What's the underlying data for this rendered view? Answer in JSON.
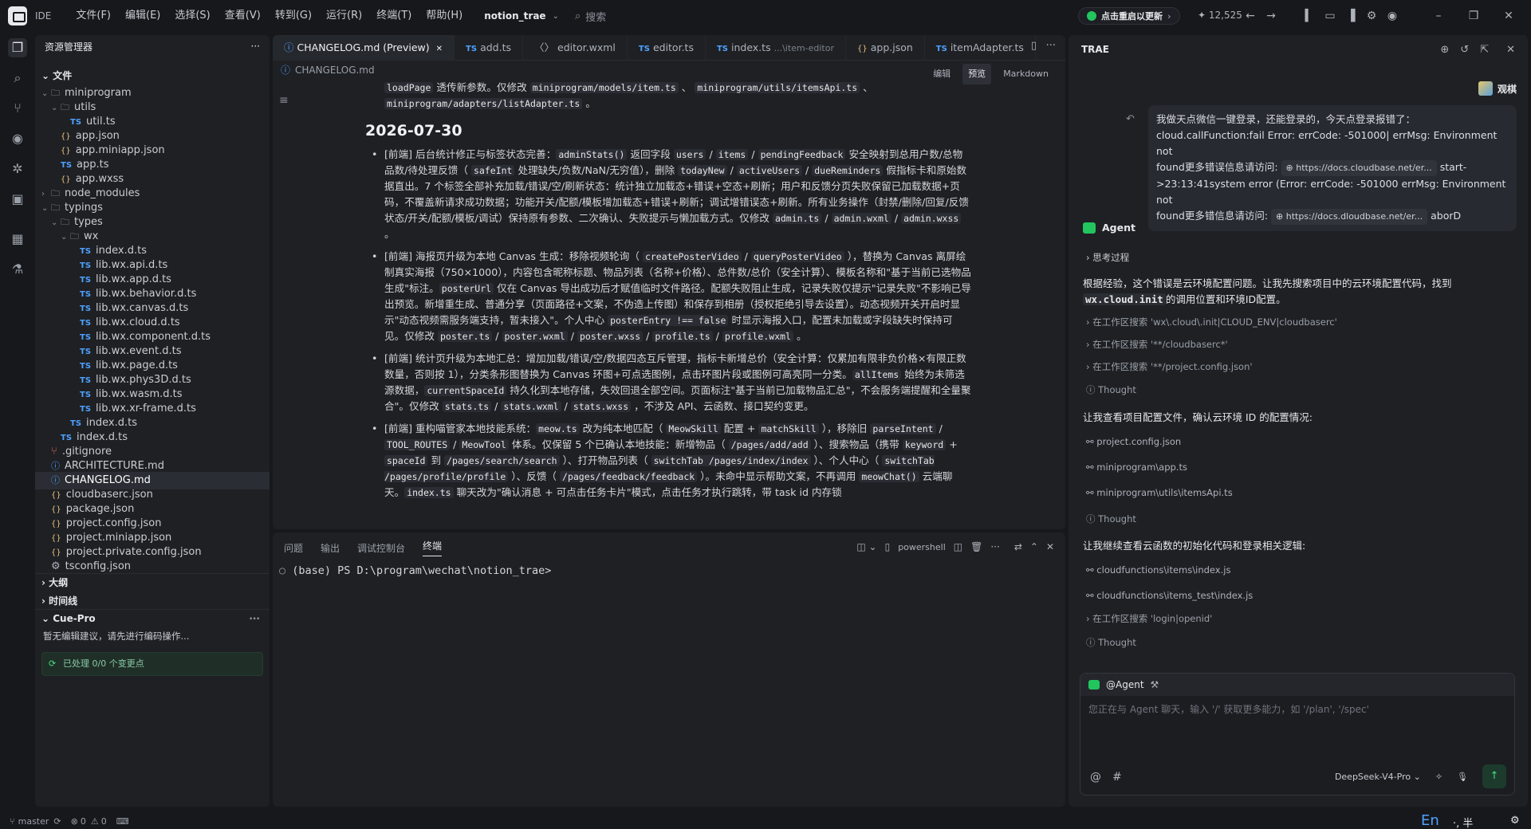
{
  "app": {
    "ide_label": "IDE",
    "project": "notion_trae",
    "search_placeholder": "搜索",
    "update_label": "点击重启以更新",
    "stars": "12,525"
  },
  "menu": [
    "文件(F)",
    "编辑(E)",
    "选择(S)",
    "查看(V)",
    "转到(G)",
    "运行(R)",
    "终端(T)",
    "帮助(H)"
  ],
  "explorer": {
    "title": "资源管理器",
    "root": "文件",
    "rows": [
      {
        "label": "miniprogram",
        "kind": "folder",
        "depth": 0,
        "chev": "v"
      },
      {
        "label": "utils",
        "kind": "folder",
        "depth": 1,
        "chev": "v"
      },
      {
        "label": "util.ts",
        "kind": "ts",
        "depth": 2
      },
      {
        "label": "app.json",
        "kind": "json",
        "depth": 1
      },
      {
        "label": "app.miniapp.json",
        "kind": "json",
        "depth": 1
      },
      {
        "label": "app.ts",
        "kind": "ts",
        "depth": 1
      },
      {
        "label": "app.wxss",
        "kind": "json",
        "depth": 1
      },
      {
        "label": "node_modules",
        "kind": "folder",
        "depth": 0,
        "chev": ">"
      },
      {
        "label": "typings",
        "kind": "folder",
        "depth": 0,
        "chev": "v"
      },
      {
        "label": "types",
        "kind": "folder",
        "depth": 1,
        "chev": "v"
      },
      {
        "label": "wx",
        "kind": "folder",
        "depth": 2,
        "chev": "v"
      },
      {
        "label": "index.d.ts",
        "kind": "ts",
        "depth": 3
      },
      {
        "label": "lib.wx.api.d.ts",
        "kind": "ts",
        "depth": 3
      },
      {
        "label": "lib.wx.app.d.ts",
        "kind": "ts",
        "depth": 3
      },
      {
        "label": "lib.wx.behavior.d.ts",
        "kind": "ts",
        "depth": 3
      },
      {
        "label": "lib.wx.canvas.d.ts",
        "kind": "ts",
        "depth": 3
      },
      {
        "label": "lib.wx.cloud.d.ts",
        "kind": "ts",
        "depth": 3
      },
      {
        "label": "lib.wx.component.d.ts",
        "kind": "ts",
        "depth": 3
      },
      {
        "label": "lib.wx.event.d.ts",
        "kind": "ts",
        "depth": 3
      },
      {
        "label": "lib.wx.page.d.ts",
        "kind": "ts",
        "depth": 3
      },
      {
        "label": "lib.wx.phys3D.d.ts",
        "kind": "ts",
        "depth": 3
      },
      {
        "label": "lib.wx.wasm.d.ts",
        "kind": "ts",
        "depth": 3
      },
      {
        "label": "lib.wx.xr-frame.d.ts",
        "kind": "ts",
        "depth": 3
      },
      {
        "label": "index.d.ts",
        "kind": "ts",
        "depth": 2
      },
      {
        "label": "index.d.ts",
        "kind": "ts",
        "depth": 1
      },
      {
        "label": ".gitignore",
        "kind": "git",
        "depth": 0
      },
      {
        "label": "ARCHITECTURE.md",
        "kind": "md",
        "depth": 0
      },
      {
        "label": "CHANGELOG.md",
        "kind": "md",
        "depth": 0,
        "selected": true
      },
      {
        "label": "cloudbaserc.json",
        "kind": "json",
        "depth": 0
      },
      {
        "label": "package.json",
        "kind": "json",
        "depth": 0
      },
      {
        "label": "project.config.json",
        "kind": "json",
        "depth": 0
      },
      {
        "label": "project.miniapp.json",
        "kind": "json",
        "depth": 0
      },
      {
        "label": "project.private.config.json",
        "kind": "json",
        "depth": 0
      },
      {
        "label": "tsconfig.json",
        "kind": "gear",
        "depth": 0
      }
    ],
    "outline": "大纲",
    "timeline": "时间线",
    "cue_title": "Cue-Pro",
    "cue_hint": "暂无编辑建议，请先进行编码操作...",
    "cue_status": "已处理 0/0 个变更点"
  },
  "editor": {
    "tabs": [
      {
        "label": "CHANGELOG.md (Preview)",
        "kind": "md",
        "active": true
      },
      {
        "label": "add.ts",
        "kind": "ts"
      },
      {
        "label": "editor.wxml",
        "kind": "xml"
      },
      {
        "label": "editor.ts",
        "kind": "ts"
      },
      {
        "label": "index.ts",
        "kind": "ts",
        "suffix": "...\\item-editor"
      },
      {
        "label": "app.json",
        "kind": "json"
      },
      {
        "label": "itemAdapter.ts",
        "kind": "ts"
      }
    ],
    "breadcrumb": "CHANGELOG.md",
    "modes": [
      "编辑",
      "预览",
      "Markdown"
    ],
    "top_line_html": "<code>loadPage</code> 透传新参数。仅修改 <code>miniprogram/models/item.ts</code> 、 <code>miniprogram/utils/itemsApi.ts</code> 、 <code>miniprogram/adapters/listAdapter.ts</code> 。",
    "heading": "2026-07-30",
    "items_html": [
      "[前端] 后台统计修正与标签状态完善：<code>adminStats()</code> 返回字段 <code>users</code> / <code>items</code> / <code>pendingFeedback</code> 安全映射到总用户数/总物品数/待处理反馈（ <code>safeInt</code> 处理缺失/负数/NaN/无穷值），删除 <code>todayNew</code> / <code>activeUsers</code> / <code>dueReminders</code> 假指标卡和原始数据直出。7 个标签全部补充加载/错误/空/刷新状态：统计独立加载态+错误+空态+刷新；用户和反馈分页失败保留已加载数据+页码，不覆盖新请求成功数据；功能开关/配额/模板增加载态+错误+刷新；调试增错误态+刷新。所有业务操作（封禁/删除/回复/反馈状态/开关/配额/模板/调试）保持原有参数、二次确认、失败提示与懒加载方式。仅修改 <code>admin.ts</code> / <code>admin.wxml</code> / <code>admin.wxss</code> 。",
      "[前端] 海报页升级为本地 Canvas 生成：移除视频轮询（ <code>createPosterVideo</code> / <code>queryPosterVideo</code> ），替换为 Canvas 离屏绘制真实海报（750×1000），内容包含昵称标题、物品列表（名称+价格）、总件数/总价（安全计算）、模板名称和\"基于当前已选物品生成\"标注。<code>posterUrl</code> 仅在 Canvas 导出成功后才赋值临时文件路径。配额失败阻止生成，记录失败仅提示\"记录失败\"不影响已导出预览。新增重生成、普通分享（页面路径+文案，不伪造上传图）和保存到相册（授权拒绝引导去设置）。动态视频开关开启时显示\"动态视频需服务端支持，暂未接入\"。个人中心 <code>posterEntry !== false</code> 时显示海报入口，配置未加载或字段缺失时保持可见。仅修改 <code>poster.ts</code> / <code>poster.wxml</code> / <code>poster.wxss</code> / <code>profile.ts</code> / <code>profile.wxml</code> 。",
      "[前端] 统计页升级为本地汇总：增加加载/错误/空/数据四态互斥管理，指标卡新增总价（安全计算：仅累加有限非负价格×有限正数数量，否则按 1），分类条形图替换为 Canvas 环图+可点选图例，点击环图片段或图例可高亮同一分类。<code>allItems</code> 始终为未筛选源数据，<code>currentSpaceId</code> 持久化到本地存储，失效回退全部空间。页面标注\"基于当前已加载物品汇总\"，不会服务端提醒和全量聚合\"。仅修改 <code>stats.ts</code> / <code>stats.wxml</code> / <code>stats.wxss</code> ，不涉及 API、云函数、接口契约变更。",
      "[前端] 重构喵管家本地技能系统：<code>meow.ts</code> 改为纯本地匹配（ <code>MeowSkill</code> 配置 + <code>matchSkill</code> ），移除旧 <code>parseIntent</code> / <code>TOOL_ROUTES</code> / <code>MeowTool</code> 体系。仅保留 5 个已确认本地技能：新增物品（ <code>/pages/add/add</code> ）、搜索物品（携带 <code>keyword</code> + <code>spaceId</code> 到 <code>/pages/search/search</code> ）、打开物品列表（ <code>switchTab /pages/index/index</code> ）、个人中心（ <code>switchTab /pages/profile/profile</code> ）、反馈（ <code>/pages/feedback/feedback</code> ）。未命中显示帮助文案，不再调用 <code>meowChat()</code> 云端聊天。<code>index.ts</code> 聊天改为\"确认消息 + 可点击任务卡片\"模式，点击任务才执行跳转，带 task id 内存锁"
    ]
  },
  "panel": {
    "tabs": [
      "问题",
      "输出",
      "调试控制台",
      "终端"
    ],
    "shell": "powershell",
    "prompt": "(base) PS D:\\program\\wechat\\notion_trae>"
  },
  "trae": {
    "title": "TRAE",
    "user_name": "观棋",
    "user_message_lines": [
      "我做天点微信一键登录，还能登录的，今天点登录报错了：",
      "cloud.callFunction:fail Error: errCode: -501000| errMsg: Environment not",
      "found更多错误信息请访问:",
      ">23:13:41system error (Error: errCode: -501000 errMsg: Environment not",
      "found更多错信息请访问:"
    ],
    "link1": "https://docs.cloudbase.net/er...",
    "link1_after": "start-",
    "link2": "https://docs.dloudbase.net/er...",
    "link2_after": "aborD",
    "agent_label": "Agent",
    "thinking": "思考过程",
    "para1_a": "根据经验，这个错误是云环境配置问题。让我先搜索项目中的云环境配置代码，找到",
    "para1_code": "wx.cloud.init",
    "para1_b": "的调用位置和环境ID配置。",
    "search1": "在工作区搜索 'wx\\.cloud\\.init|CLOUD_ENV|cloudbaserc'",
    "search2": "在工作区搜索 '**/cloudbaserc*'",
    "search3": "在工作区搜索 '**/project.config.json'",
    "thought": "Thought",
    "para2": "让我查看项目配置文件，确认云环境 ID 的配置情况:",
    "refs1": [
      "project.config.json",
      "miniprogram\\app.ts",
      "miniprogram\\utils\\itemsApi.ts"
    ],
    "para3": "让我继续查看云函数的初始化代码和登录相关逻辑:",
    "refs2": [
      "cloudfunctions\\items\\index.js",
      "cloudfunctions\\items_test\\index.js"
    ],
    "search4": "在工作区搜索 'login|openid'",
    "composer_chip": "@Agent",
    "composer_placeholder": "您正在与 Agent 聊天，输入 '/' 获取更多能力，如 '/plan', '/spec'",
    "model": "DeepSeek-V4-Pro"
  },
  "status": {
    "branch": "master",
    "errors": "0",
    "warnings": "0",
    "ime": "En",
    "ime_mode": "·, 半"
  }
}
